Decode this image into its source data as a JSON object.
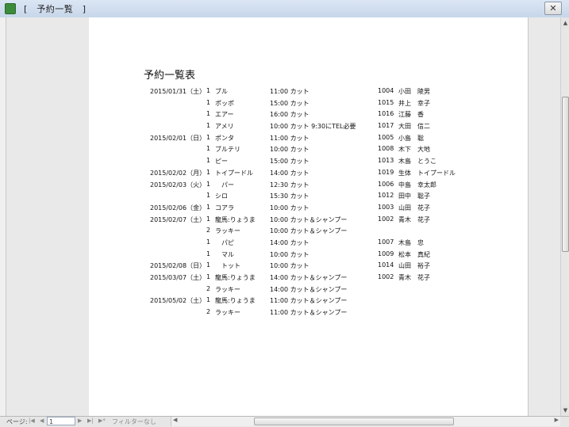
{
  "window": {
    "title": "[　予約一覧　]",
    "close_label": "✕"
  },
  "report": {
    "title": "予約一覧表",
    "rows": [
      {
        "date": "2015/01/31（土）",
        "num": "1",
        "name": "ブル",
        "time_menu": "11:00  カット",
        "id": "1004",
        "customer": "小田　陵男"
      },
      {
        "date": "",
        "num": "1",
        "name": "ポッポ",
        "time_menu": "15:00  カット",
        "id": "1015",
        "customer": "井上　幸子"
      },
      {
        "date": "",
        "num": "1",
        "name": "エアー",
        "time_menu": "16:00  カット",
        "id": "1016",
        "customer": "江藤　香"
      },
      {
        "date": "",
        "num": "1",
        "name": "アメリ",
        "time_menu": "10:00  カット 9:30にTEL必要",
        "id": "1017",
        "customer": "大田　信二"
      },
      {
        "date": "2015/02/01（日）",
        "num": "1",
        "name": "ポンタ",
        "time_menu": "11:00  カット",
        "id": "1005",
        "customer": "小島　聡"
      },
      {
        "date": "",
        "num": "1",
        "name": "ブルテリ",
        "time_menu": "10:00  カット",
        "id": "1008",
        "customer": "木下　大地"
      },
      {
        "date": "",
        "num": "1",
        "name": "ピー",
        "time_menu": "15:00  カット",
        "id": "1013",
        "customer": "木島　とうこ"
      },
      {
        "date": "2015/02/02（月）",
        "num": "1",
        "name": "トイプードル",
        "time_menu": "14:00  カット",
        "id": "1019",
        "customer": "生体　トイプードル"
      },
      {
        "date": "2015/02/03（火）",
        "num": "1",
        "name": "　パー",
        "time_menu": "12:30  カット",
        "id": "1006",
        "customer": "中島　幸太郎"
      },
      {
        "date": "",
        "num": "1",
        "name": "シロ",
        "time_menu": "15:30  カット",
        "id": "1012",
        "customer": "田中　聡子"
      },
      {
        "date": "2015/02/06（金）",
        "num": "1",
        "name": "コアラ",
        "time_menu": "10:00  カット",
        "id": "1003",
        "customer": "山田　花子"
      },
      {
        "date": "2015/02/07（土）",
        "num": "1",
        "name": "龍馬:りょうま",
        "time_menu": "10:00 カット＆シャンプー",
        "id": "1002",
        "customer": "青木　花子"
      },
      {
        "date": "",
        "num": "2",
        "name": "ラッキー",
        "time_menu": "10:00 カット＆シャンプー",
        "id": "",
        "customer": ""
      },
      {
        "date": "",
        "num": "1",
        "name": "　パピ",
        "time_menu": "14:00  カット",
        "id": "1007",
        "customer": "木島　忠"
      },
      {
        "date": "",
        "num": "1",
        "name": "　マル",
        "time_menu": "10:00  カット",
        "id": "1009",
        "customer": "松本　真紀"
      },
      {
        "date": "2015/02/08（日）",
        "num": "1",
        "name": "　トット",
        "time_menu": "10:00  カット",
        "id": "1014",
        "customer": "山田　裕子"
      },
      {
        "date": "2015/03/07（土）",
        "num": "1",
        "name": "龍馬:りょうま",
        "time_menu": "14:00 カット＆シャンプー",
        "id": "1002",
        "customer": "青木　花子"
      },
      {
        "date": "",
        "num": "2",
        "name": "ラッキー",
        "time_menu": "14:00 カット＆シャンプー",
        "id": "",
        "customer": ""
      },
      {
        "date": "2015/05/02（土）",
        "num": "1",
        "name": "龍馬:りょうま",
        "time_menu": "11:00 カット＆シャンプー",
        "id": "",
        "customer": ""
      },
      {
        "date": "",
        "num": "2",
        "name": "ラッキー",
        "time_menu": "11:00 カット＆シャンプー",
        "id": "",
        "customer": ""
      }
    ]
  },
  "navigation": {
    "page_label": "ページ:",
    "first": "|◀",
    "prev": "◀",
    "page_value": "1",
    "next": "▶",
    "last": "▶|",
    "new": "▶*",
    "filter_label": "フィルターなし",
    "hscroll_left": "◀",
    "hscroll_right": "▶",
    "vscroll_up": "▲",
    "vscroll_down": "▼"
  }
}
